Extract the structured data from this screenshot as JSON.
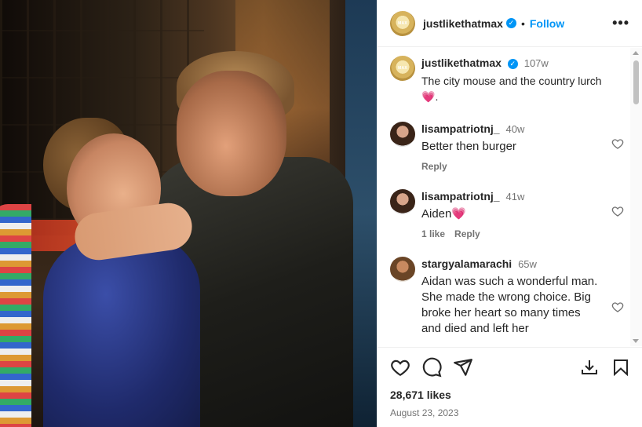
{
  "post": {
    "author": "justlikethatmax",
    "follow_label": "Follow",
    "separator": "•",
    "more_label": "•••",
    "caption_time": "107w",
    "caption_text": "The city mouse and the country lurch",
    "caption_emoji": "💗",
    "caption_tail": ".",
    "likes": "28,671 likes",
    "date": "August 23, 2023"
  },
  "comments": [
    {
      "user": "lisampatriotnj_",
      "time": "40w",
      "text": "Better then burger",
      "emoji": "",
      "like_count": "",
      "reply_label": "Reply"
    },
    {
      "user": "lisampatriotnj_",
      "time": "41w",
      "text": "Aiden",
      "emoji": "💗",
      "like_count": "1 like",
      "reply_label": "Reply"
    },
    {
      "user": "stargyalamarachi",
      "time": "65w",
      "text": "Aidan was such a wonderful man. She made the wrong choice. Big broke her heart so many times and died and left her",
      "emoji": "",
      "like_count": "",
      "reply_label": ""
    }
  ],
  "colors": {
    "accent": "#0095f6",
    "text": "#262626",
    "muted": "#737373",
    "heart": "#e4405f"
  },
  "icons": [
    "heart-icon",
    "comment-icon",
    "share-icon",
    "download-icon",
    "bookmark-icon",
    "verified-badge-icon"
  ]
}
